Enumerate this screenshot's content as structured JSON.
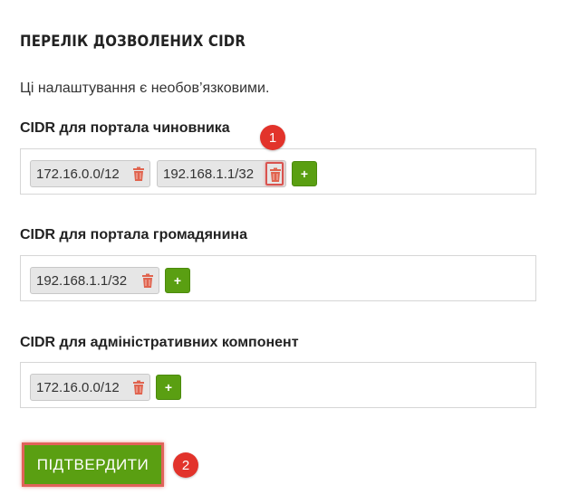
{
  "page": {
    "title": "ПЕРЕЛІК ДОЗВОЛЕНИХ CIDR",
    "subtitle": "Ці налаштування є необов’язковими."
  },
  "sections": [
    {
      "label": "CIDR для портала чиновника",
      "chips": [
        "172.16.0.0/12",
        "192.168.1.1/32"
      ],
      "add_label": "+"
    },
    {
      "label": "CIDR для портала громадянина",
      "chips": [
        "192.168.1.1/32"
      ],
      "add_label": "+"
    },
    {
      "label": "CIDR для адміністративних компонент",
      "chips": [
        "172.16.0.0/12"
      ],
      "add_label": "+"
    }
  ],
  "confirm_button": {
    "label": "ПІДТВЕРДИТИ"
  },
  "callouts": [
    "1",
    "2"
  ],
  "colors": {
    "accent_green": "#5a9f12",
    "trash_red": "#e0634e",
    "callout_red": "#e2332b",
    "highlight_border": "#d9534f"
  },
  "icons": {
    "trash": "trash-icon",
    "add": "plus-icon"
  }
}
